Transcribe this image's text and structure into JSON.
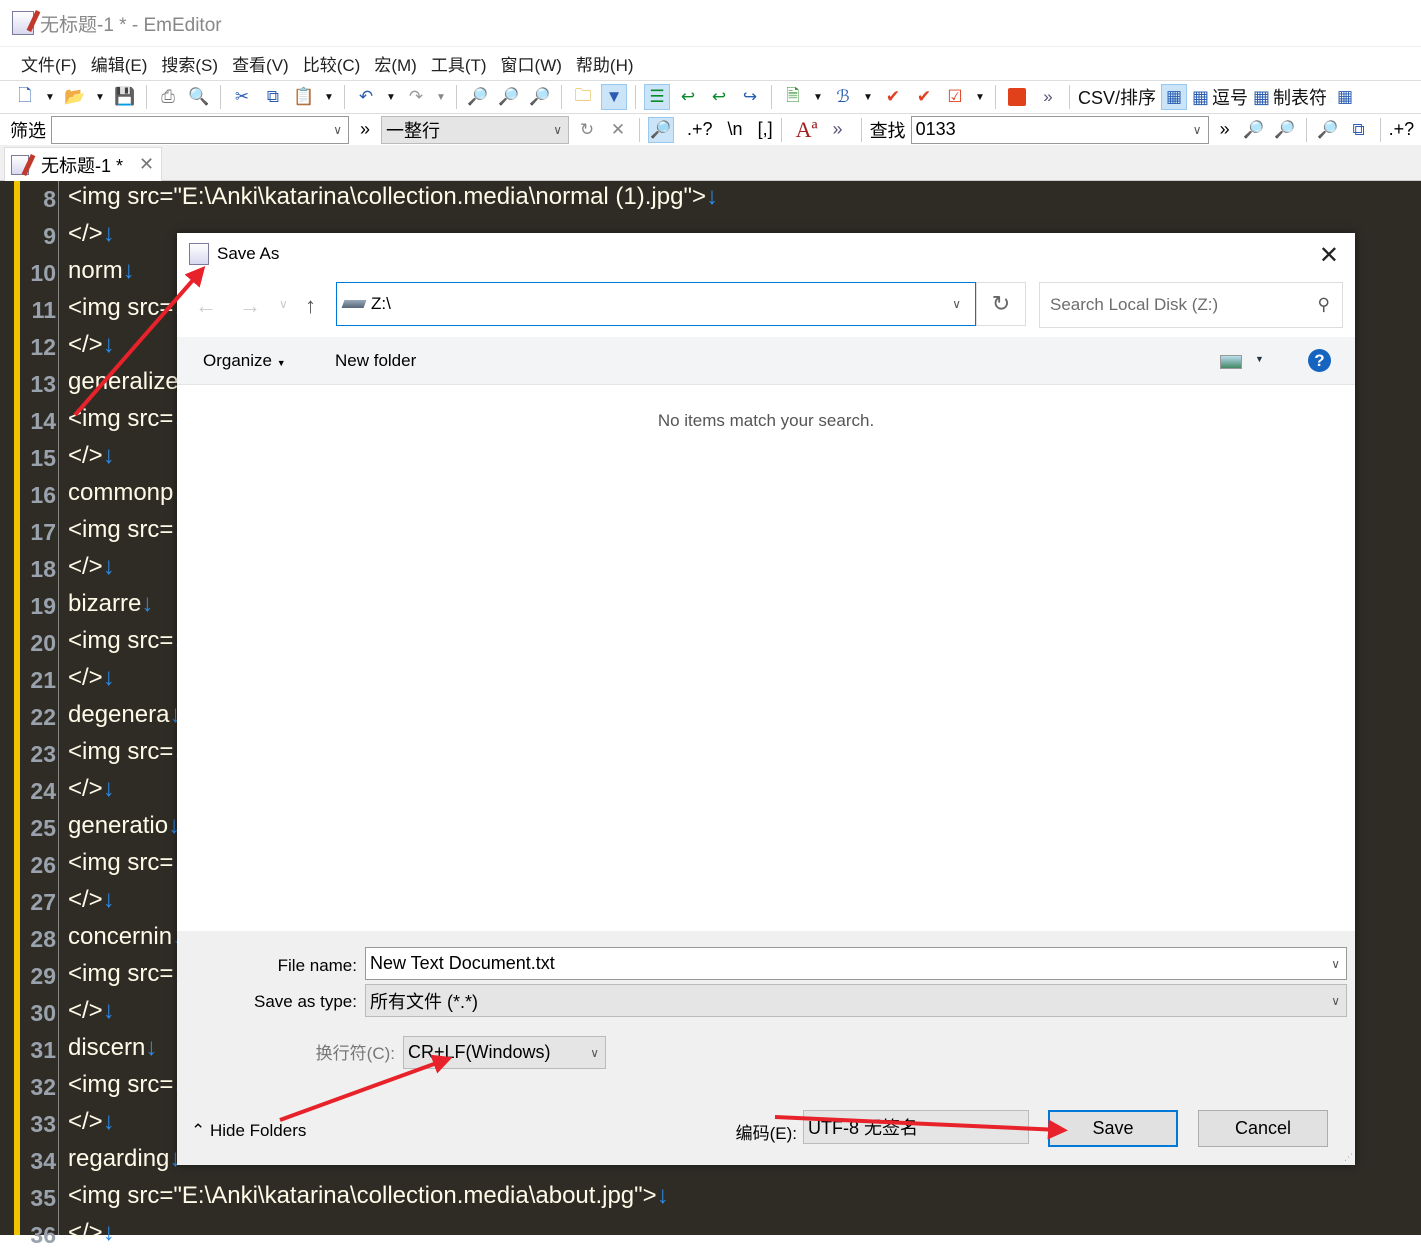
{
  "window": {
    "title": "无标题-1 * - EmEditor"
  },
  "menu": [
    "文件(F)",
    "编辑(E)",
    "搜索(S)",
    "查看(V)",
    "比较(C)",
    "宏(M)",
    "工具(T)",
    "窗口(W)",
    "帮助(H)"
  ],
  "toolbar": {
    "csv_sort": "CSV/排序",
    "comma": "逗号",
    "tab_sep": "制表符"
  },
  "filterbar": {
    "label": "筛选",
    "filter_value": "",
    "mode": "一整行",
    "regex": ".+?",
    "newline": "\\n",
    "bracket": "[,]"
  },
  "findbar": {
    "label": "查找",
    "value": "0133",
    "regex": ".+?"
  },
  "tab": {
    "label": "无标题-1 *"
  },
  "editor": {
    "lines": [
      {
        "n": "8",
        "t": "<img src=\"E:\\Anki\\katarina\\collection.media\\normal (1).jpg\">"
      },
      {
        "n": "9",
        "t": "</>"
      },
      {
        "n": "10",
        "t": "norm"
      },
      {
        "n": "11",
        "t": "<img src="
      },
      {
        "n": "12",
        "t": "</>"
      },
      {
        "n": "13",
        "t": "generalize"
      },
      {
        "n": "14",
        "t": "<img src="
      },
      {
        "n": "15",
        "t": "</>"
      },
      {
        "n": "16",
        "t": "commonp"
      },
      {
        "n": "17",
        "t": "<img src="
      },
      {
        "n": "18",
        "t": "</>"
      },
      {
        "n": "19",
        "t": "bizarre"
      },
      {
        "n": "20",
        "t": "<img src="
      },
      {
        "n": "21",
        "t": "</>"
      },
      {
        "n": "22",
        "t": "degenera"
      },
      {
        "n": "23",
        "t": "<img src="
      },
      {
        "n": "24",
        "t": "</>"
      },
      {
        "n": "25",
        "t": "generatio"
      },
      {
        "n": "26",
        "t": "<img src="
      },
      {
        "n": "27",
        "t": "</>"
      },
      {
        "n": "28",
        "t": "concernin"
      },
      {
        "n": "29",
        "t": "<img src="
      },
      {
        "n": "30",
        "t": "</>"
      },
      {
        "n": "31",
        "t": "discern"
      },
      {
        "n": "32",
        "t": "<img src="
      },
      {
        "n": "33",
        "t": "</>"
      },
      {
        "n": "34",
        "t": "regarding"
      },
      {
        "n": "35",
        "t": "<img src=\"E:\\Anki\\katarina\\collection.media\\about.jpg\">"
      },
      {
        "n": "36",
        "t": "</>"
      }
    ],
    "newline_mark": "↓"
  },
  "dialog": {
    "title": "Save As",
    "address": "Z:\\",
    "search_placeholder": "Search Local Disk (Z:)",
    "organize": "Organize",
    "new_folder": "New folder",
    "empty_message": "No items match your search.",
    "file_name_label": "File name:",
    "file_name": "New Text Document.txt",
    "save_type_label": "Save as type:",
    "save_type": "所有文件 (*.*)",
    "newline_label": "换行符(C):",
    "newline_value": "CR+LF(Windows)",
    "encoding_label": "编码(E):",
    "encoding_value": "UTF-8 无签名",
    "hide_folders": "Hide Folders",
    "save": "Save",
    "cancel": "Cancel"
  },
  "colors": {
    "editor_bg": "#2f2c26",
    "accent": "#0078d7",
    "arrow": "#e8222a",
    "gutter_marker": "#f0c400"
  }
}
